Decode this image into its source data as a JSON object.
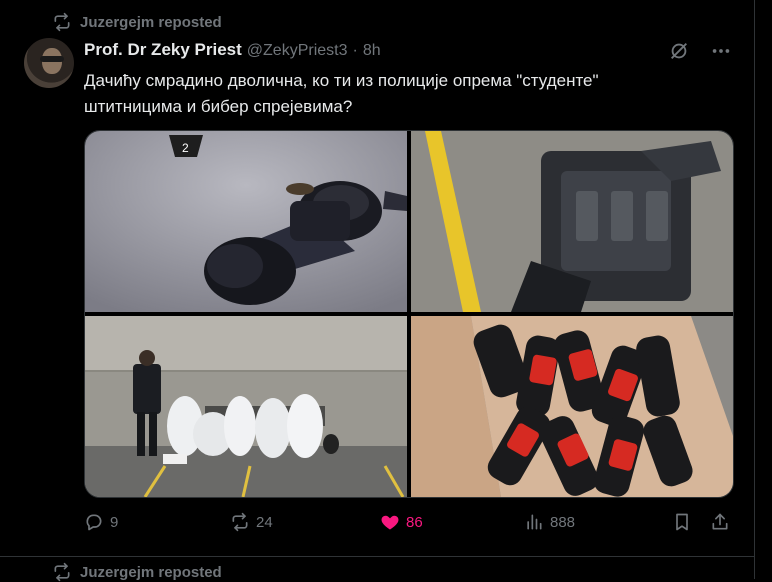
{
  "repost": {
    "label": "Juzergejm reposted"
  },
  "next_repost": {
    "label": "Juzergejm reposted"
  },
  "author": {
    "name": "Prof. Dr Zeky Priest",
    "handle": "@ZekyPriest3",
    "separator": "·",
    "time": "8h"
  },
  "post": {
    "line1": "Дачићу смрадино дволична, ко ти из полиције опрема \"студенте\"",
    "line2": "штитницима и бибер спрејевима?"
  },
  "media": {
    "marker_label": "2"
  },
  "actions": {
    "replies": "9",
    "reposts": "24",
    "likes": "86",
    "views": "888"
  },
  "colors": {
    "background": "#000000",
    "text": "#e7e9ea",
    "muted": "#71767b",
    "like": "#f91880",
    "divider": "#2f3336"
  }
}
